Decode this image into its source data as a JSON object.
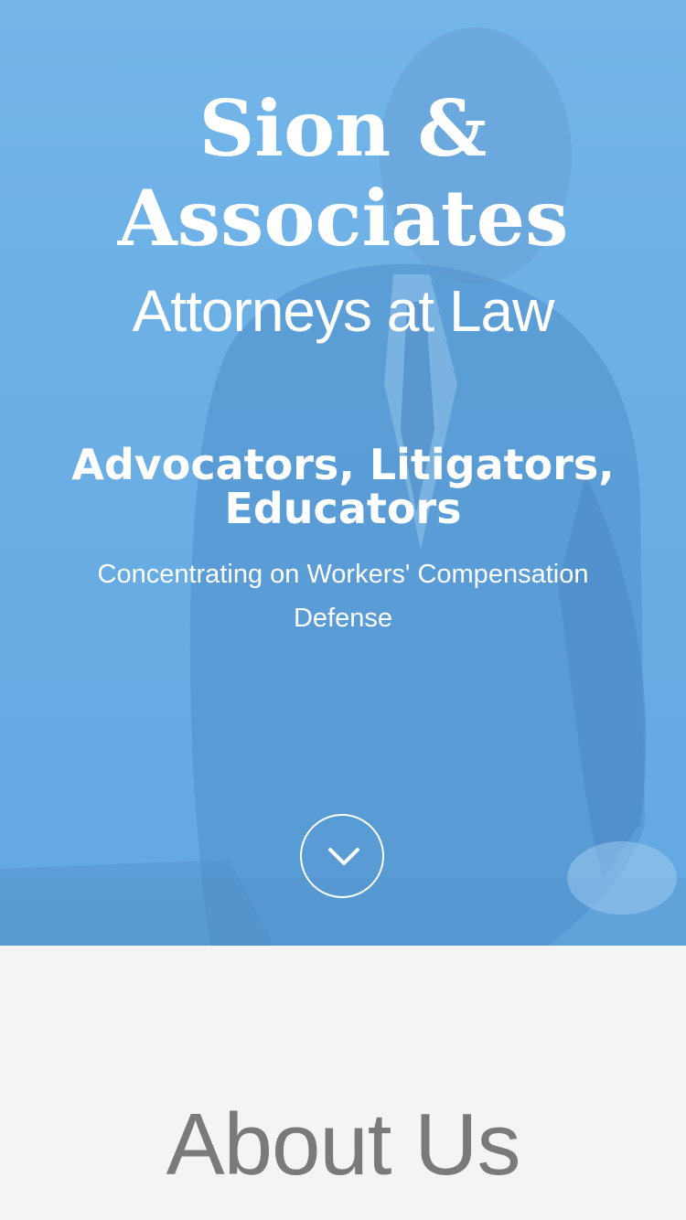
{
  "hero": {
    "firm_name": "Sion & Associates",
    "firm_subtitle": "Attorneys at Law",
    "tagline": "Advocators, Litigators, Educators",
    "focus_text": "Concentrating on Workers' Compensation Defense",
    "scroll_icon": "chevron-down-icon",
    "overlay_color": "#6aaee4"
  },
  "about": {
    "title": "About Us",
    "background": "#f4f4f4",
    "title_color": "#7a7a7a"
  }
}
